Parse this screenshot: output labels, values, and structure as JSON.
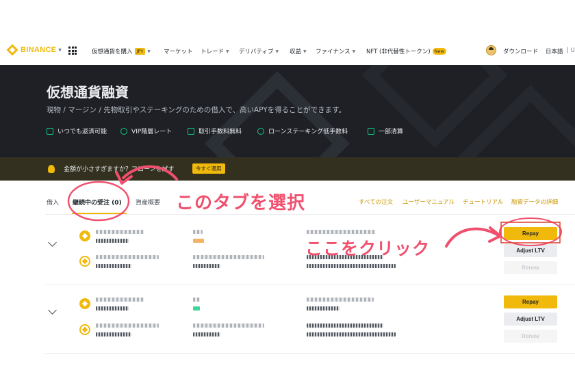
{
  "nav": {
    "logo_text": "BINANCE",
    "items": [
      {
        "label": "仮想通貨を購入",
        "badge": "JPY"
      },
      {
        "label": "マーケット"
      },
      {
        "label": "トレード"
      },
      {
        "label": "デリバティブ"
      },
      {
        "label": "収益"
      },
      {
        "label": "ファイナンス"
      },
      {
        "label": "NFT (非代替性トークン)",
        "badge": "New"
      }
    ],
    "download": "ダウンロード",
    "language": "日本語",
    "currency_partial": "U"
  },
  "hero": {
    "title": "仮想通貨融資",
    "subtitle": "現物 / マージン / 先物取引やステーキングのための借入で、高いAPYを得ることができます。",
    "features": [
      "いつでも返済可能",
      "VIP階層レート",
      "取引手数料無料",
      "ローンステーキング低手数料",
      "一部清算"
    ]
  },
  "promo": {
    "text": "金額が小さすぎますか？フローンを試す",
    "button": "今すぐ適用"
  },
  "tabs": {
    "items": [
      "借入",
      "継続中の受注 (0)",
      "資産概要"
    ],
    "active_index": 1,
    "links": [
      "すべての注文",
      "ユーザーマニュアル",
      "チュートリアル",
      "融資データの詳細"
    ]
  },
  "rows": [
    {
      "actions": {
        "repay": "Repay",
        "adjust": "Adjust LTV",
        "renew": "Renew"
      }
    },
    {
      "actions": {
        "repay": "Repay",
        "adjust": "Adjust LTV",
        "renew": "Renew"
      }
    }
  ],
  "annotations": {
    "select_tab": "このタブを選択",
    "click_here": "ここをクリック"
  },
  "colors": {
    "accent": "#F0B90B",
    "hero_bg": "#1e2026",
    "annotation": "#f0506e",
    "link": "#c99400"
  }
}
